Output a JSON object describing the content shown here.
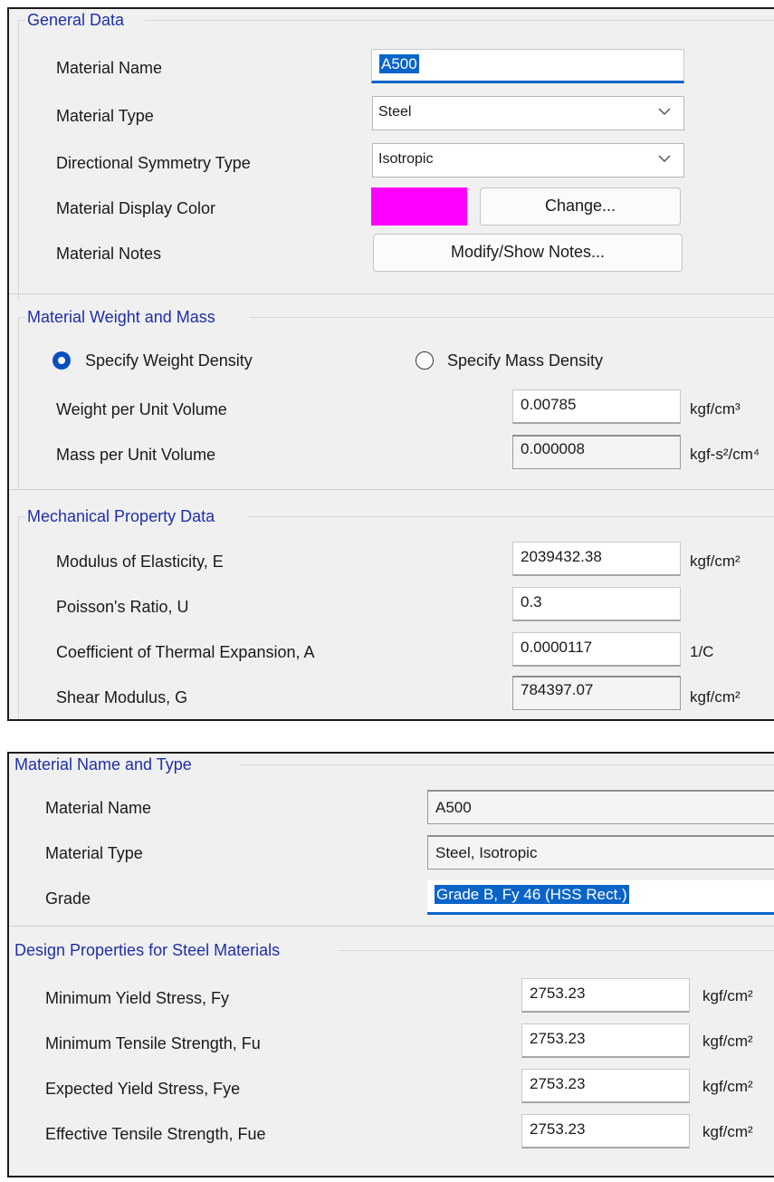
{
  "general": {
    "title": "General Data",
    "material_name": {
      "label": "Material Name",
      "value": "A500"
    },
    "material_type": {
      "label": "Material Type",
      "value": "Steel"
    },
    "symmetry": {
      "label": "Directional Symmetry Type",
      "value": "Isotropic"
    },
    "display_color": {
      "label": "Material Display Color",
      "color": "#ff00ff",
      "button": "Change..."
    },
    "notes": {
      "label": "Material Notes",
      "button": "Modify/Show Notes..."
    }
  },
  "weight_mass": {
    "title": "Material Weight and Mass",
    "radio_weight": {
      "label": "Specify Weight Density",
      "selected": true
    },
    "radio_mass": {
      "label": "Specify Mass Density",
      "selected": false
    },
    "weight": {
      "label": "Weight per Unit Volume",
      "value": "0.00785",
      "unit": "kgf/cm³"
    },
    "mass": {
      "label": "Mass per Unit Volume",
      "value": "0.000008",
      "unit": "kgf-s²/cm⁴"
    }
  },
  "mechanical": {
    "title": "Mechanical Property Data",
    "modulus": {
      "label": "Modulus of Elasticity,  E",
      "value": "2039432.38",
      "unit": "kgf/cm²"
    },
    "poisson": {
      "label": "Poisson's Ratio,  U",
      "value": "0.3"
    },
    "thermal": {
      "label": "Coefficient of Thermal Expansion,  A",
      "value": "0.0000117",
      "unit": "1/C"
    },
    "shear": {
      "label": "Shear Modulus,  G",
      "value": "784397.07",
      "unit": "kgf/cm²"
    }
  },
  "name_type": {
    "title": "Material Name and Type",
    "material_name": {
      "label": "Material Name",
      "value": "A500"
    },
    "material_type": {
      "label": "Material Type",
      "value": "Steel, Isotropic"
    },
    "grade": {
      "label": "Grade",
      "value": "Grade B, Fy 46 (HSS Rect.)"
    }
  },
  "design": {
    "title": "Design Properties for Steel Materials",
    "fy": {
      "label": "Minimum Yield Stress, Fy",
      "value": "2753.23",
      "unit": "kgf/cm²"
    },
    "fu": {
      "label": "Minimum Tensile Strength, Fu",
      "value": "2753.23",
      "unit": "kgf/cm²"
    },
    "fye": {
      "label": "Expected Yield Stress, Fye",
      "value": "2753.23",
      "unit": "kgf/cm²"
    },
    "fue": {
      "label": "Effective Tensile Strength, Fue",
      "value": "2753.23",
      "unit": "kgf/cm²"
    }
  },
  "icons": {
    "dropdown": "chevron-down-icon"
  },
  "colors": {
    "accent": "#0a64c8",
    "group_title": "#1f2fa8",
    "display_color": "#ff00ff"
  }
}
